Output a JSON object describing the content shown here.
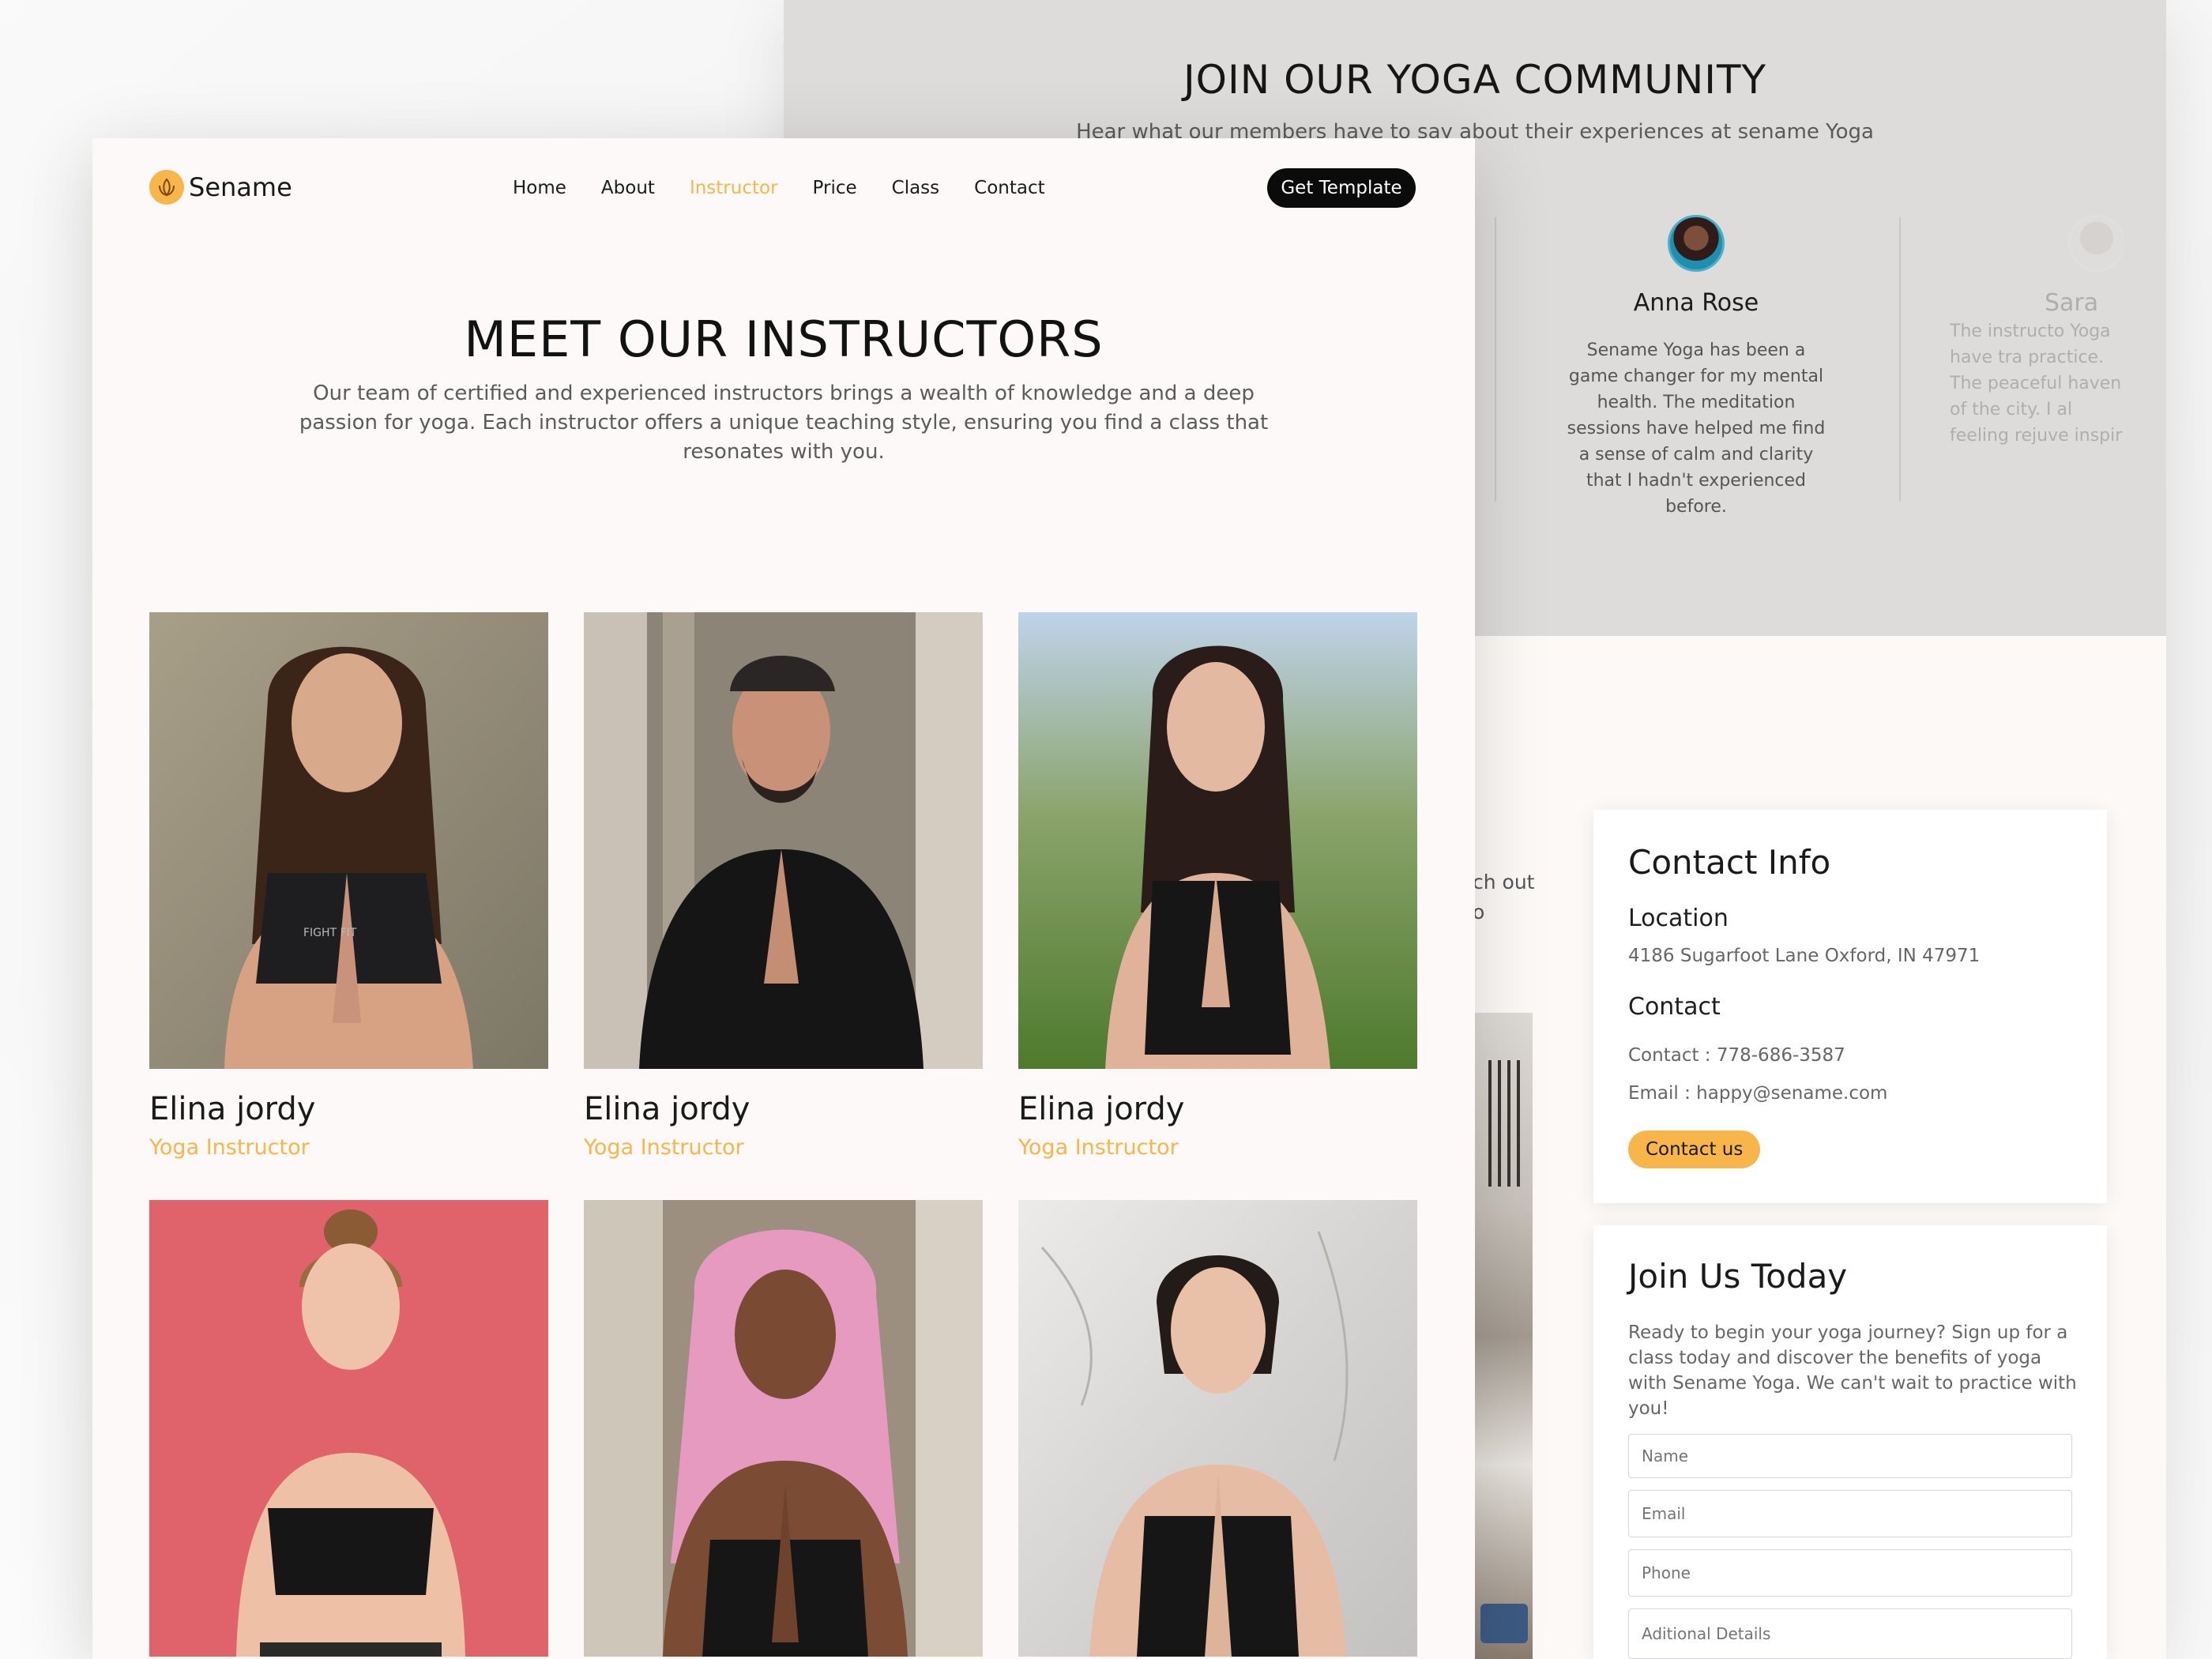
{
  "community": {
    "title": "JOIN OUR YOGA COMMUNITY",
    "subtitle": "Hear what our members have to say about their experiences at sename Yoga",
    "testimonials": [
      {
        "name": "Anna Rose",
        "quote": "Sename Yoga has been a game changer for my mental health. The meditation sessions have helped me find a sense of calm and clarity that I hadn't experienced before."
      },
      {
        "name": "Sara",
        "quote": "The instructo Yoga have tra practice. The peaceful haven of the city. I al feeling rejuve inspir"
      }
    ]
  },
  "reach": {
    "line1": "ch out",
    "line2": "o"
  },
  "contact_info": {
    "title": "Contact Info",
    "location_heading": "Location",
    "address": "4186 Sugarfoot Lane Oxford, IN 47971",
    "contact_heading": "Contact",
    "phone": "Contact : 778-686-3587",
    "email": "Email : happy@sename.com",
    "button": "Contact us"
  },
  "join": {
    "title": "Join Us Today",
    "text": "Ready to begin your yoga journey? Sign up for a class today and discover the benefits of yoga with Sename Yoga. We can't wait to practice with you!",
    "fields": {
      "name": "Name",
      "email": "Email",
      "phone": "Phone",
      "details": "Aditional Details"
    }
  },
  "nav": {
    "brand": "Sename",
    "links": [
      "Home",
      "About",
      "Instructor",
      "Price",
      "Class",
      "Contact"
    ],
    "active": "Instructor",
    "cta": "Get Template"
  },
  "hero": {
    "title": "MEET OUR INSTRUCTORS",
    "subtitle": "Our team of certified and experienced instructors brings a wealth of knowledge and a deep passion for yoga. Each instructor offers a unique teaching style, ensuring you find a class that resonates with you."
  },
  "instructors": [
    {
      "name": "Elina jordy",
      "role": "Yoga Instructor",
      "shirt_text": "FIGHT FIT"
    },
    {
      "name": "Elina jordy",
      "role": "Yoga Instructor"
    },
    {
      "name": "Elina jordy",
      "role": "Yoga Instructor"
    },
    {
      "name": "",
      "role": ""
    },
    {
      "name": "",
      "role": ""
    },
    {
      "name": "",
      "role": ""
    }
  ],
  "colors": {
    "accent": "#f8b54a",
    "dark": "#0b0b0b",
    "page_bg": "#fcf9f8",
    "community_bg": "#dedcdb"
  }
}
